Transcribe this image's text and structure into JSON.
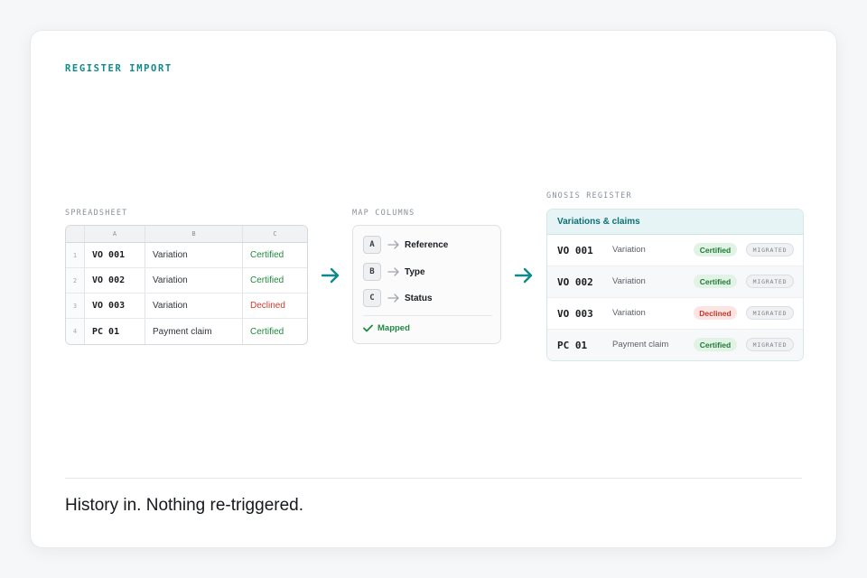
{
  "eyebrow": "REGISTER IMPORT",
  "spreadsheet": {
    "label": "SPREADSHEET",
    "columns": [
      "A",
      "B",
      "C"
    ],
    "rows": [
      {
        "index": "1",
        "ref": "VO 001",
        "type": "Variation",
        "status": "Certified"
      },
      {
        "index": "2",
        "ref": "VO 002",
        "type": "Variation",
        "status": "Certified"
      },
      {
        "index": "3",
        "ref": "VO 003",
        "type": "Variation",
        "status": "Declined"
      },
      {
        "index": "4",
        "ref": "PC 01",
        "type": "Payment claim",
        "status": "Certified"
      }
    ]
  },
  "map_columns": {
    "label": "MAP COLUMNS",
    "mappings": [
      {
        "key": "A",
        "field": "Reference"
      },
      {
        "key": "B",
        "field": "Type"
      },
      {
        "key": "C",
        "field": "Status"
      }
    ],
    "mapped_label": "Mapped"
  },
  "register": {
    "label": "GNOSIS REGISTER",
    "title": "Variations & claims",
    "rows": [
      {
        "ref": "VO 001",
        "type": "Variation",
        "status": "Certified",
        "badge": "MIGRATED"
      },
      {
        "ref": "VO 002",
        "type": "Variation",
        "status": "Certified",
        "badge": "MIGRATED"
      },
      {
        "ref": "VO 003",
        "type": "Variation",
        "status": "Declined",
        "badge": "MIGRATED"
      },
      {
        "ref": "PC 01",
        "type": "Payment claim",
        "status": "Certified",
        "badge": "MIGRATED"
      }
    ]
  },
  "tagline": "History in. Nothing re-triggered.",
  "colors": {
    "accent": "#0f8a8a",
    "certified": "#1f8a3e",
    "declined": "#d03a2c"
  },
  "icons": {
    "flow_arrow": "arrow-right-icon",
    "map_arrow": "arrow-right-icon",
    "mapped": "check-icon"
  }
}
